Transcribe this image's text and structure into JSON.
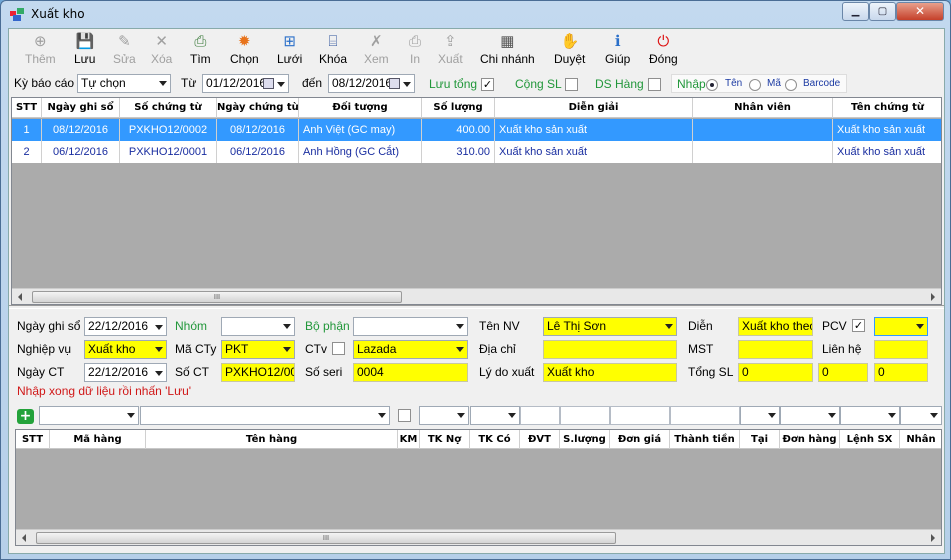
{
  "window": {
    "title": "Xuất kho"
  },
  "toolbar": [
    {
      "label": "Thêm",
      "icon": "add-icon",
      "enabled": false
    },
    {
      "label": "Lưu",
      "icon": "save-icon",
      "enabled": true
    },
    {
      "label": "Sửa",
      "icon": "edit-icon",
      "enabled": false
    },
    {
      "label": "Xóa",
      "icon": "delete-icon",
      "enabled": false
    },
    {
      "label": "Tìm",
      "icon": "find-icon",
      "enabled": true
    },
    {
      "label": "Chọn",
      "icon": "gear-icon",
      "enabled": true
    },
    {
      "label": "Lưới",
      "icon": "grid-icon",
      "enabled": true
    },
    {
      "label": "Khóa",
      "icon": "lock-icon",
      "enabled": true
    },
    {
      "label": "Xem",
      "icon": "view-icon",
      "enabled": false
    },
    {
      "label": "In",
      "icon": "print-icon",
      "enabled": false
    },
    {
      "label": "Xuất",
      "icon": "export-icon",
      "enabled": false
    },
    {
      "label": "Chi nhánh",
      "icon": "branch-icon",
      "enabled": true
    },
    {
      "label": "Duyệt",
      "icon": "approve-icon",
      "enabled": true
    },
    {
      "label": "Giúp",
      "icon": "help-icon",
      "enabled": true
    },
    {
      "label": "Đóng",
      "icon": "power-icon",
      "enabled": true
    }
  ],
  "filter": {
    "period_label": "Kỳ báo cáo",
    "period_value": "Tự chọn",
    "from_label": "Từ",
    "from_value": "01/12/2016",
    "to_label": "đến",
    "to_value": "08/12/2016",
    "luu_tong_label": "Lưu tổng",
    "luu_tong_checked": true,
    "cong_sl_label": "Cộng SL",
    "ds_hang_label": "DS Hàng",
    "nhap_label": "Nhập",
    "radio_ten": "Tên",
    "radio_ma": "Mã",
    "radio_barcode": "Barcode"
  },
  "top_grid": {
    "columns": [
      "STT",
      "Ngày ghi sổ",
      "Số chứng từ",
      "Ngày chứng từ",
      "Đối tượng",
      "Số lượng",
      "Diễn giải",
      "Nhân viên",
      "Tên chứng từ"
    ],
    "rows": [
      [
        "1",
        "08/12/2016",
        "PXKHO12/0002",
        "08/12/2016",
        "Anh Việt (GC may)",
        "400.00",
        "Xuất kho sản xuất",
        "",
        "Xuất kho sản xuất"
      ],
      [
        "2",
        "06/12/2016",
        "PXKHO12/0001",
        "06/12/2016",
        "Anh Hồng (GC Cắt)",
        "310.00",
        "Xuất kho sản xuất",
        "",
        "Xuất kho sản xuất"
      ]
    ],
    "scroll_grip": "III"
  },
  "form": {
    "ngay_ghi_so_label": "Ngày ghi sổ",
    "ngay_ghi_so": "22/12/2016",
    "nhom_label": "Nhóm",
    "bo_phan_label": "Bộ phận",
    "ten_nv_label": "Tên NV",
    "ten_nv": "Lê Thị Sơn",
    "dien_label": "Diễn",
    "dien": "Xuất kho  theo",
    "pcv_label": "PCV",
    "nghiep_vu_label": "Nghiệp vụ",
    "nghiep_vu": "Xuất kho",
    "ma_cty_label": "Mã CTy",
    "ma_cty": "PKT",
    "ctv_label": "CTv",
    "ctv": "Lazada",
    "dia_chi_label": "Địa chỉ",
    "mst_label": "MST",
    "lien_he_label": "Liên hệ",
    "ngay_ct_label": "Ngày CT",
    "ngay_ct": "22/12/2016",
    "so_ct_label": "Số CT",
    "so_ct": "PXKHO12/000",
    "so_seri_label": "Số seri",
    "so_seri": "0004",
    "ly_do_label": "Lý do xuất",
    "ly_do": "Xuất kho",
    "tong_sl_label": "Tổng SL",
    "tong_1": "0",
    "tong_2": "0",
    "tong_3": "0",
    "hint": "Nhập xong dữ liệu rồi nhấn 'Lưu'"
  },
  "bottom_grid": {
    "columns": [
      "STT",
      "Mã hàng",
      "Tên hàng",
      "KM",
      "TK Nợ",
      "TK Có",
      "ĐVT",
      "S.lượng",
      "Đơn giá",
      "Thành tiền",
      "Tại",
      "Đơn hàng",
      "Lệnh SX",
      "Nhân"
    ],
    "scroll_grip": "III"
  },
  "colors": {
    "accent": "#3399ff",
    "highlight": "#ffff00",
    "green_label": "#21973a"
  }
}
